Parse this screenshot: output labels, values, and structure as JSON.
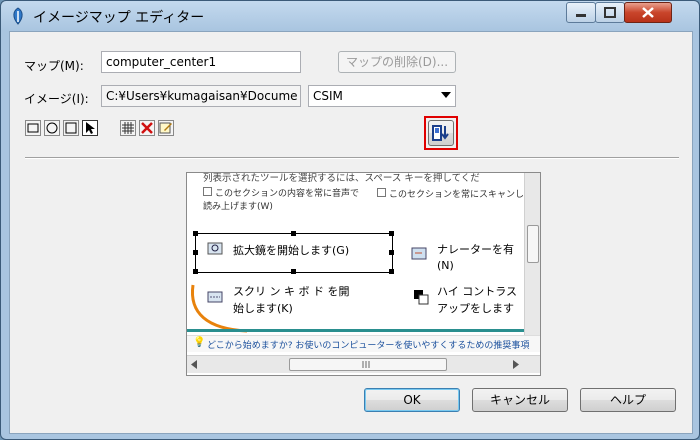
{
  "window": {
    "title": "イメージマップ エディター",
    "controls": {
      "minimize": "–",
      "maximize": "□",
      "close": "✕"
    }
  },
  "form": {
    "map_label": "マップ(M):",
    "map_value": "computer_center1",
    "delete_map_button": "マップの削除(D)...",
    "image_label": "イメージ(I):",
    "image_value": "C:¥Users¥kumagaisan¥Docume",
    "format_value": "CSIM"
  },
  "toolbar": {
    "tools": [
      "rectangle-tool-icon",
      "circle-tool-icon",
      "polygon-tool-icon",
      "pointer-tool-icon",
      "grid-tool-icon",
      "delete-tool-icon",
      "edit-tool-icon"
    ],
    "highlight_color": "#e00000"
  },
  "preview": {
    "line1": "列表示されたツールを選択するには、スペース キーを押してくだ",
    "check1": "このセクションの内容を常に音声で読み上げます(W)",
    "check2": "このセクションを常にスキャンし",
    "magnifier": "拡大鏡を開始します(G)",
    "narrator": "ナレーターを有",
    "narrator2": "(N)",
    "osk1": "スクリ ン キ ボ ド を開",
    "osk2": "始します(K)",
    "contrast1": "ハイ コントラス",
    "contrast2": "アップをします",
    "tip": "どこから始めますか? お使いのコンピューターを使いやすくするための推奨事項",
    "orange": "#e8820c",
    "teal": "#2a8f8f"
  },
  "buttons": {
    "ok": "OK",
    "cancel": "キャンセル",
    "help": "ヘルプ"
  }
}
